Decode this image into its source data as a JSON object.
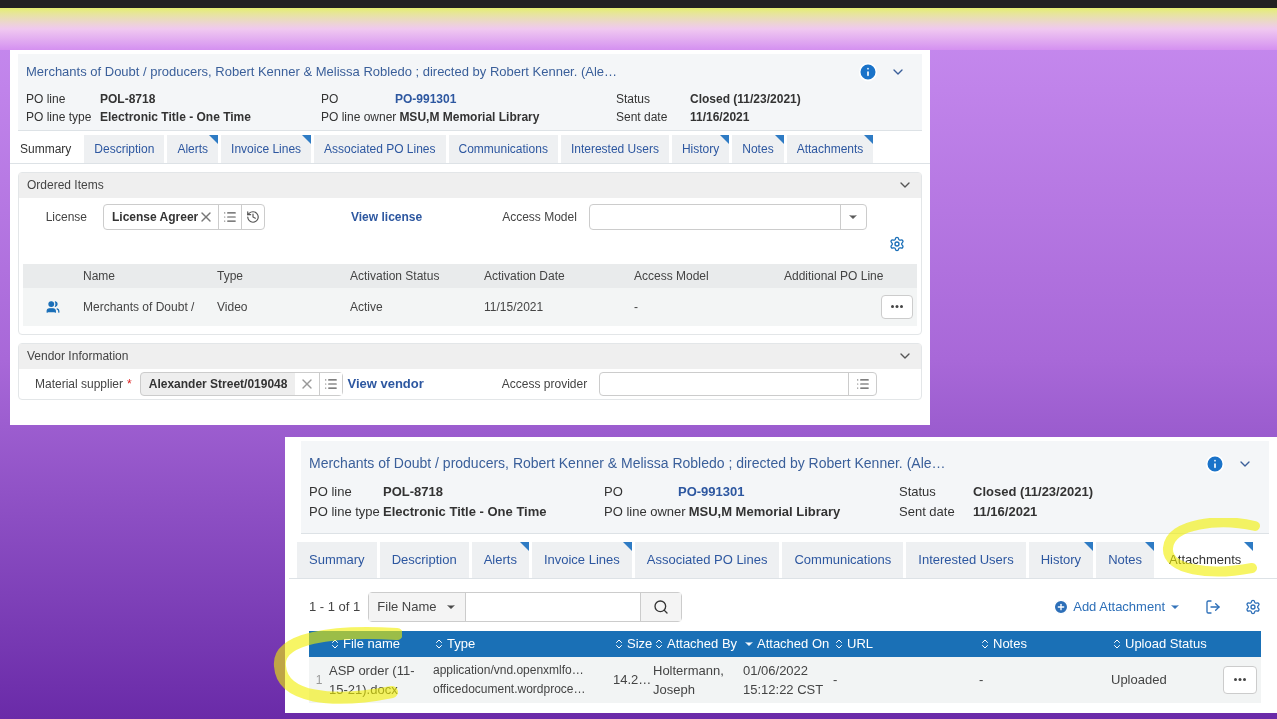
{
  "panels": [
    {
      "kind": "ordered_items",
      "title": "Merchants of Doubt / producers, Robert Kenner & Melissa Robledo ; directed by Robert Kenner. (Ale…",
      "fields": [
        {
          "label": "PO line",
          "value": "POL-8718",
          "link": false
        },
        {
          "label": "PO line type",
          "value": "Electronic Title - One Time",
          "link": false
        },
        {
          "label": "PO",
          "value": "PO-991301",
          "link": true
        },
        {
          "label": "PO line owner",
          "value": "MSU,M Memorial Library",
          "link": false
        },
        {
          "label": "Status",
          "value": "Closed (11/23/2021)",
          "link": false
        },
        {
          "label": "Sent date",
          "value": "11/16/2021",
          "link": false
        }
      ],
      "tabs": [
        {
          "label": "Summary",
          "selected": true,
          "flagged": false
        },
        {
          "label": "Description",
          "selected": false,
          "flagged": false
        },
        {
          "label": "Alerts",
          "selected": false,
          "flagged": true
        },
        {
          "label": "Invoice Lines",
          "selected": false,
          "flagged": true
        },
        {
          "label": "Associated PO Lines",
          "selected": false,
          "flagged": false
        },
        {
          "label": "Communications",
          "selected": false,
          "flagged": false
        },
        {
          "label": "Interested Users",
          "selected": false,
          "flagged": false
        },
        {
          "label": "History",
          "selected": false,
          "flagged": true
        },
        {
          "label": "Notes",
          "selected": false,
          "flagged": true
        },
        {
          "label": "Attachments",
          "selected": false,
          "flagged": true
        }
      ],
      "ordered_items": {
        "heading": "Ordered Items",
        "license_label": "License",
        "license_value": "License Agreer",
        "license_link": "View license",
        "access_model_label": "Access Model",
        "columns": [
          "Name",
          "Type",
          "Activation Status",
          "Activation Date",
          "Access Model",
          "Additional PO Line"
        ],
        "rows": [
          [
            "Merchants of Doubt /",
            "Video",
            "Active",
            "11/15/2021",
            "-",
            ""
          ]
        ]
      },
      "vendor": {
        "heading": "Vendor Information",
        "supplier_label": "Material supplier",
        "required_mark": "*",
        "supplier_value": "Alexander Street/019048",
        "vendor_link": "View vendor",
        "access_provider_label": "Access provider"
      }
    },
    {
      "kind": "attachments",
      "title": "Merchants of Doubt / producers, Robert Kenner & Melissa Robledo ; directed by Robert Kenner. (Ale…",
      "fields": [
        {
          "label": "PO line",
          "value": "POL-8718",
          "link": false
        },
        {
          "label": "PO line type",
          "value": "Electronic Title - One Time",
          "link": false
        },
        {
          "label": "PO",
          "value": "PO-991301",
          "link": true
        },
        {
          "label": "PO line owner",
          "value": "MSU,M Memorial Library",
          "link": false
        },
        {
          "label": "Status",
          "value": "Closed (11/23/2021)",
          "link": false
        },
        {
          "label": "Sent date",
          "value": "11/16/2021",
          "link": false
        }
      ],
      "tabs": [
        {
          "label": "Summary",
          "selected": false,
          "flagged": false
        },
        {
          "label": "Description",
          "selected": false,
          "flagged": false
        },
        {
          "label": "Alerts",
          "selected": false,
          "flagged": true
        },
        {
          "label": "Invoice Lines",
          "selected": false,
          "flagged": true
        },
        {
          "label": "Associated PO Lines",
          "selected": false,
          "flagged": false
        },
        {
          "label": "Communications",
          "selected": false,
          "flagged": false
        },
        {
          "label": "Interested Users",
          "selected": false,
          "flagged": false
        },
        {
          "label": "History",
          "selected": false,
          "flagged": true
        },
        {
          "label": "Notes",
          "selected": false,
          "flagged": true
        },
        {
          "label": "Attachments",
          "selected": true,
          "flagged": true
        }
      ],
      "attachments": {
        "count": "1 - 1 of 1",
        "search_scope": "File Name",
        "add_button": "Add Attachment",
        "columns": [
          {
            "label": "File name",
            "sorted_desc": false
          },
          {
            "label": "Type",
            "sorted_desc": false
          },
          {
            "label": "Size",
            "sorted_desc": false
          },
          {
            "label": "Attached By",
            "sorted_desc": false
          },
          {
            "label": "Attached On",
            "sorted_desc": true
          },
          {
            "label": "URL",
            "sorted_desc": false
          },
          {
            "label": "Notes",
            "sorted_desc": false
          },
          {
            "label": "Upload Status",
            "sorted_desc": false
          }
        ],
        "rows": [
          {
            "index": "1",
            "cells": [
              "ASP order (11-15-21).docx",
              "application/vnd.openxmlfo… officedocument.wordproce…",
              "14.2…",
              "Holtermann, Joseph",
              "01/06/2022 15:12:22 CST",
              "-",
              "-",
              "Uploaded"
            ]
          }
        ]
      }
    }
  ]
}
